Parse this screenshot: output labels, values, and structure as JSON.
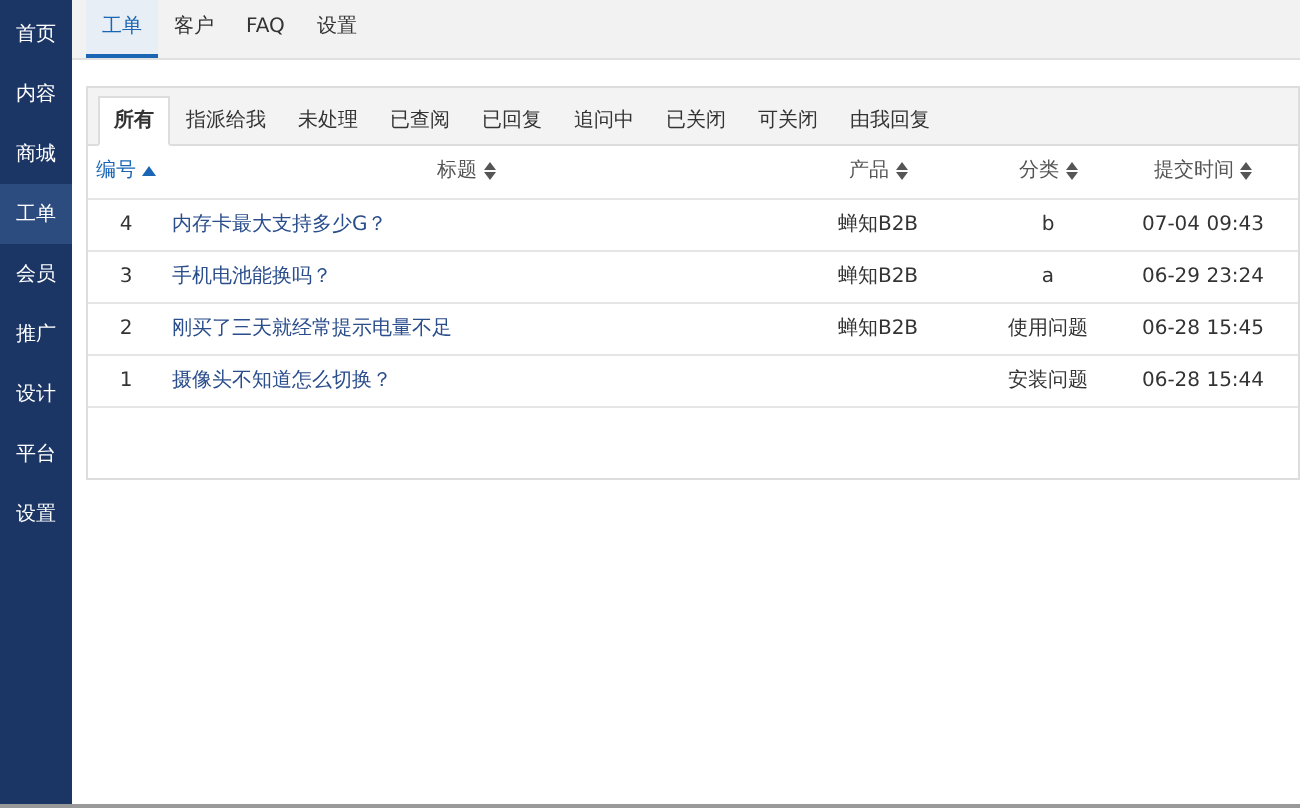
{
  "sidebar": {
    "items": [
      {
        "label": "首页",
        "selected": false
      },
      {
        "label": "内容",
        "selected": false
      },
      {
        "label": "商城",
        "selected": false
      },
      {
        "label": "工单",
        "selected": true
      },
      {
        "label": "会员",
        "selected": false
      },
      {
        "label": "推广",
        "selected": false
      },
      {
        "label": "设计",
        "selected": false
      },
      {
        "label": "平台",
        "selected": false
      },
      {
        "label": "设置",
        "selected": false
      }
    ]
  },
  "top_tabs": [
    {
      "label": "工单",
      "selected": true
    },
    {
      "label": "客户",
      "selected": false
    },
    {
      "label": "FAQ",
      "selected": false
    },
    {
      "label": "设置",
      "selected": false
    }
  ],
  "filter_tabs": [
    {
      "label": "所有",
      "selected": true
    },
    {
      "label": "指派给我",
      "selected": false
    },
    {
      "label": "未处理",
      "selected": false
    },
    {
      "label": "已查阅",
      "selected": false
    },
    {
      "label": "已回复",
      "selected": false
    },
    {
      "label": "追问中",
      "selected": false
    },
    {
      "label": "已关闭",
      "selected": false
    },
    {
      "label": "可关闭",
      "selected": false
    },
    {
      "label": "由我回复",
      "selected": false
    }
  ],
  "table": {
    "columns": [
      {
        "label": "编号",
        "sorted": true
      },
      {
        "label": "标题",
        "sorted": false
      },
      {
        "label": "产品",
        "sorted": false
      },
      {
        "label": "分类",
        "sorted": false
      },
      {
        "label": "提交时间",
        "sorted": false
      }
    ],
    "rows": [
      [
        "4",
        "内存卡最大支持多少G？",
        "蝉知B2B",
        "b",
        "07-04 09:43"
      ],
      [
        "3",
        "手机电池能换吗？",
        "蝉知B2B",
        "a",
        "06-29 23:24"
      ],
      [
        "2",
        "刚买了三天就经常提示电量不足",
        "蝉知B2B",
        "使用问题",
        "06-28 15:45"
      ],
      [
        "1",
        "摄像头不知道怎么切换？",
        "",
        "安装问题",
        "06-28 15:44"
      ]
    ]
  }
}
